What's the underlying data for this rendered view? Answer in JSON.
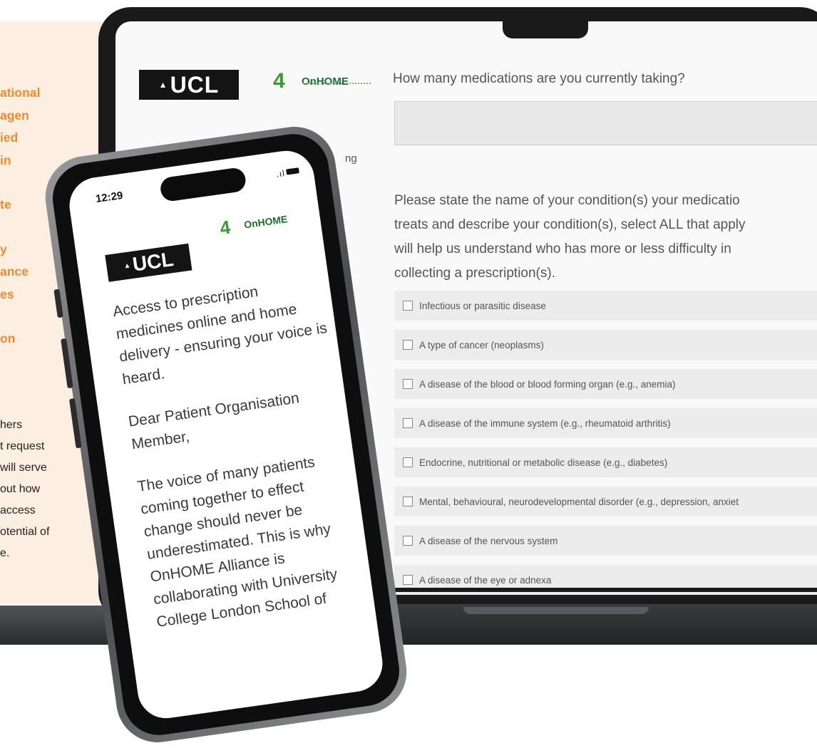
{
  "left_panel": {
    "orange_lines": [
      "ational",
      "agen",
      "ied",
      "in",
      "",
      "te",
      "",
      "y",
      "ance",
      "es",
      "",
      "on"
    ],
    "black_lines": [
      "hers",
      "t request",
      " will serve",
      "out how",
      "access",
      "otential of",
      "e."
    ]
  },
  "laptop": {
    "ucl_logo": "UCL",
    "onhome_logo": "OnHOME",
    "question": "How many medications are you currently taking?",
    "partial_text": "ng",
    "instructions": [
      "Please state the name of your condition(s) your medicatio",
      "treats and describe your condition(s), select ALL that apply",
      "will help us understand who has more or less difficulty in",
      "collecting a prescription(s)."
    ],
    "options": [
      "Infectious or parasitic disease",
      "A type of cancer (neoplasms)",
      "A disease of the blood or blood forming organ (e.g., anemia)",
      "A disease of the immune system (e.g., rheumatoid arthritis)",
      "Endocrine, nutritional or metabolic disease (e.g., diabetes)",
      "Mental, behavioural, neurodevelopmental disorder (e.g., depression, anxiet",
      "A disease of the nervous system",
      "A disease of the eye or adnexa"
    ]
  },
  "phone": {
    "time": "12:29",
    "ucl_logo": "UCL",
    "onhome_logo": "OnHOME",
    "body_lines": [
      "Access to prescription",
      "medicines online and home",
      "delivery - ensuring your voice is",
      "heard.",
      "",
      "Dear Patient Organisation",
      "Member,",
      "",
      "The voice of many patients",
      "coming together to effect",
      "change should never be",
      "underestimated. This is why",
      "OnHOME Alliance is",
      "collaborating with University",
      "College London School of"
    ]
  },
  "colors": {
    "accent_orange": "#f08a2c",
    "panel_bg": "#fdeee2",
    "brand_green": "#3c9b38"
  }
}
